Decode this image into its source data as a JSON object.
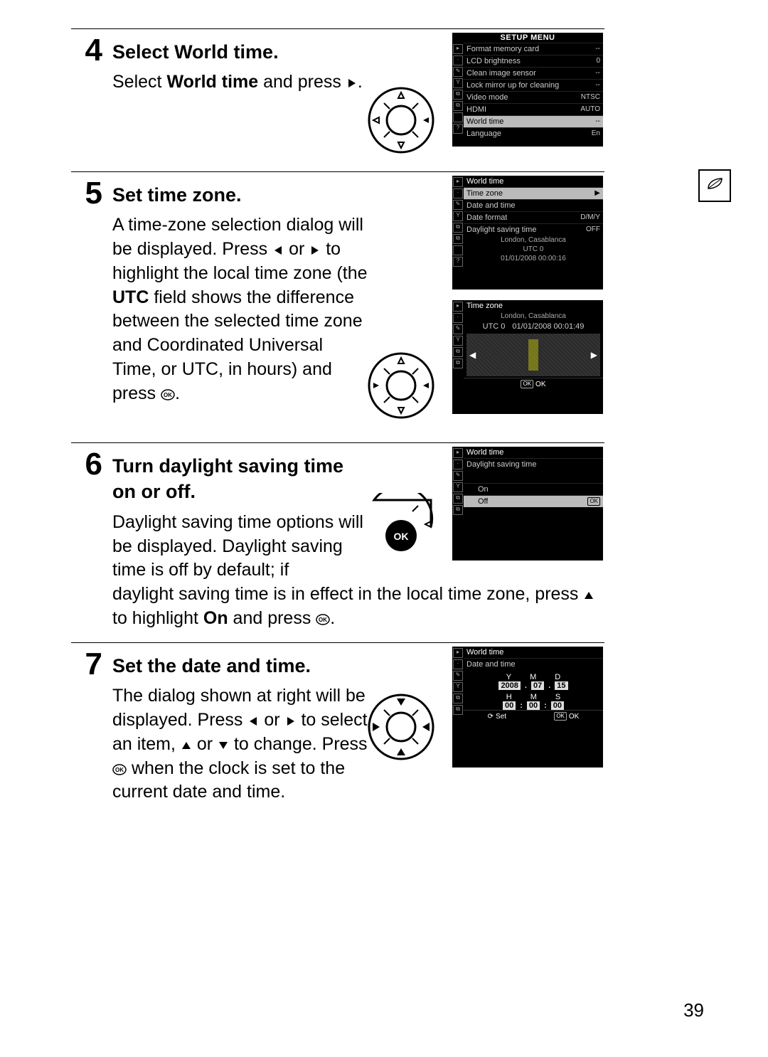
{
  "page_number": "39",
  "side_tab_icon": "leaf-icon",
  "steps": {
    "s4": {
      "num": "4",
      "title": "Select World time.",
      "text": "Select World time and press ▶."
    },
    "s5": {
      "num": "5",
      "title": "Set time zone.",
      "text": "A time-zone selection dialog will be displayed.  Press ◀ or ▶ to highlight the local time zone (the UTC field shows the difference between the selected time zone and Coordinated Universal Time, or UTC, in hours) and press ⊛."
    },
    "s6": {
      "num": "6",
      "title": "Turn daylight saving time on or off.",
      "text": "Daylight saving time options will be displayed.  Daylight saving time is off by default; if daylight saving time is in effect in the local time zone, press ▲ to highlight On and press ⊛."
    },
    "s7": {
      "num": "7",
      "title": "Set the date and time.",
      "text": "The dialog shown at right will be displayed.  Press ◀ or ▶ to select an item, ▲ or ▼ to change.  Press ⊛ when the clock is set to the current date and time."
    }
  },
  "lcd_setup": {
    "title": "SETUP MENU",
    "rows": [
      {
        "lbl": "Format memory card",
        "val": "--"
      },
      {
        "lbl": "LCD brightness",
        "val": "0"
      },
      {
        "lbl": "Clean image sensor",
        "val": "--"
      },
      {
        "lbl": "Lock mirror up for cleaning",
        "val": "--"
      },
      {
        "lbl": "Video mode",
        "val": "NTSC"
      },
      {
        "lbl": "HDMI",
        "val": "AUTO"
      },
      {
        "lbl": "World time",
        "val": "--",
        "hl": true
      },
      {
        "lbl": "Language",
        "val": "En"
      }
    ]
  },
  "lcd_worldtime_menu": {
    "title": "World time",
    "rows": [
      {
        "lbl": "Time zone",
        "val": "▶",
        "hl": true
      },
      {
        "lbl": "Date and time",
        "val": ""
      },
      {
        "lbl": "Date format",
        "val": "D/M/Y"
      },
      {
        "lbl": "Daylight saving time",
        "val": "OFF"
      }
    ],
    "tz_name": "London, Casablanca",
    "utc": "UTC  0",
    "timestamp": "01/01/2008 00:00:16"
  },
  "lcd_timezone": {
    "title": "Time zone",
    "tz_name": "London, Casablanca",
    "utc": "UTC  0",
    "timestamp": "01/01/2008 00:01:49",
    "left_arrow": "◀",
    "right_arrow": "▶",
    "ok_label": "OK",
    "ok_box": "OK"
  },
  "lcd_dst": {
    "title": "World time",
    "subtitle": "Daylight saving time",
    "on": "On",
    "off": "Off",
    "ok_box": "OK"
  },
  "lcd_datetime": {
    "title": "World time",
    "subtitle": "Date and time",
    "y_label": "Y",
    "m_label": "M",
    "d_label": "D",
    "y_val": "2008",
    "mo_val": "07",
    "d_val": "15",
    "h_label": "H",
    "mi_label": "M",
    "s_label": "S",
    "h_val": "00",
    "mi_val": "00",
    "s_val": "00",
    "set_label": "Set",
    "ok_label": "OK",
    "ok_box": "OK"
  }
}
